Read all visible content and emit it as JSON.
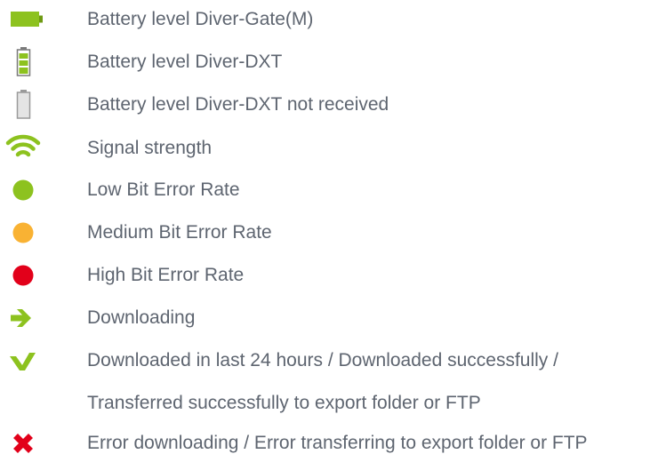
{
  "legend": {
    "colors": {
      "green": "#8dc21f",
      "dark_green": "#6e9a12",
      "orange": "#f9b233",
      "red": "#e2001a",
      "grey_body": "#e4e4e4",
      "grey_outline": "#9a9a9a",
      "text": "#5e6570"
    },
    "items": [
      {
        "icon": "battery-horizontal-full-icon",
        "label": "Battery level Diver-Gate(M)"
      },
      {
        "icon": "battery-vertical-full-icon",
        "label": "Battery level Diver-DXT"
      },
      {
        "icon": "battery-vertical-empty-icon",
        "label": "Battery level Diver-DXT not received"
      },
      {
        "icon": "signal-strength-icon",
        "label": "Signal strength"
      },
      {
        "icon": "green-dot-icon",
        "label": "Low Bit Error Rate"
      },
      {
        "icon": "orange-dot-icon",
        "label": "Medium Bit Error Rate"
      },
      {
        "icon": "red-dot-icon",
        "label": "High Bit Error Rate"
      },
      {
        "icon": "arrow-right-icon",
        "label": "Downloading"
      },
      {
        "icon": "checkmark-icon",
        "label": "Downloaded in last 24 hours / Downloaded successfully /"
      },
      {
        "icon": "",
        "label": "Transferred successfully to export folder or FTP"
      },
      {
        "icon": "cross-icon",
        "label": "Error downloading / Error transferring to export folder or FTP"
      }
    ]
  }
}
